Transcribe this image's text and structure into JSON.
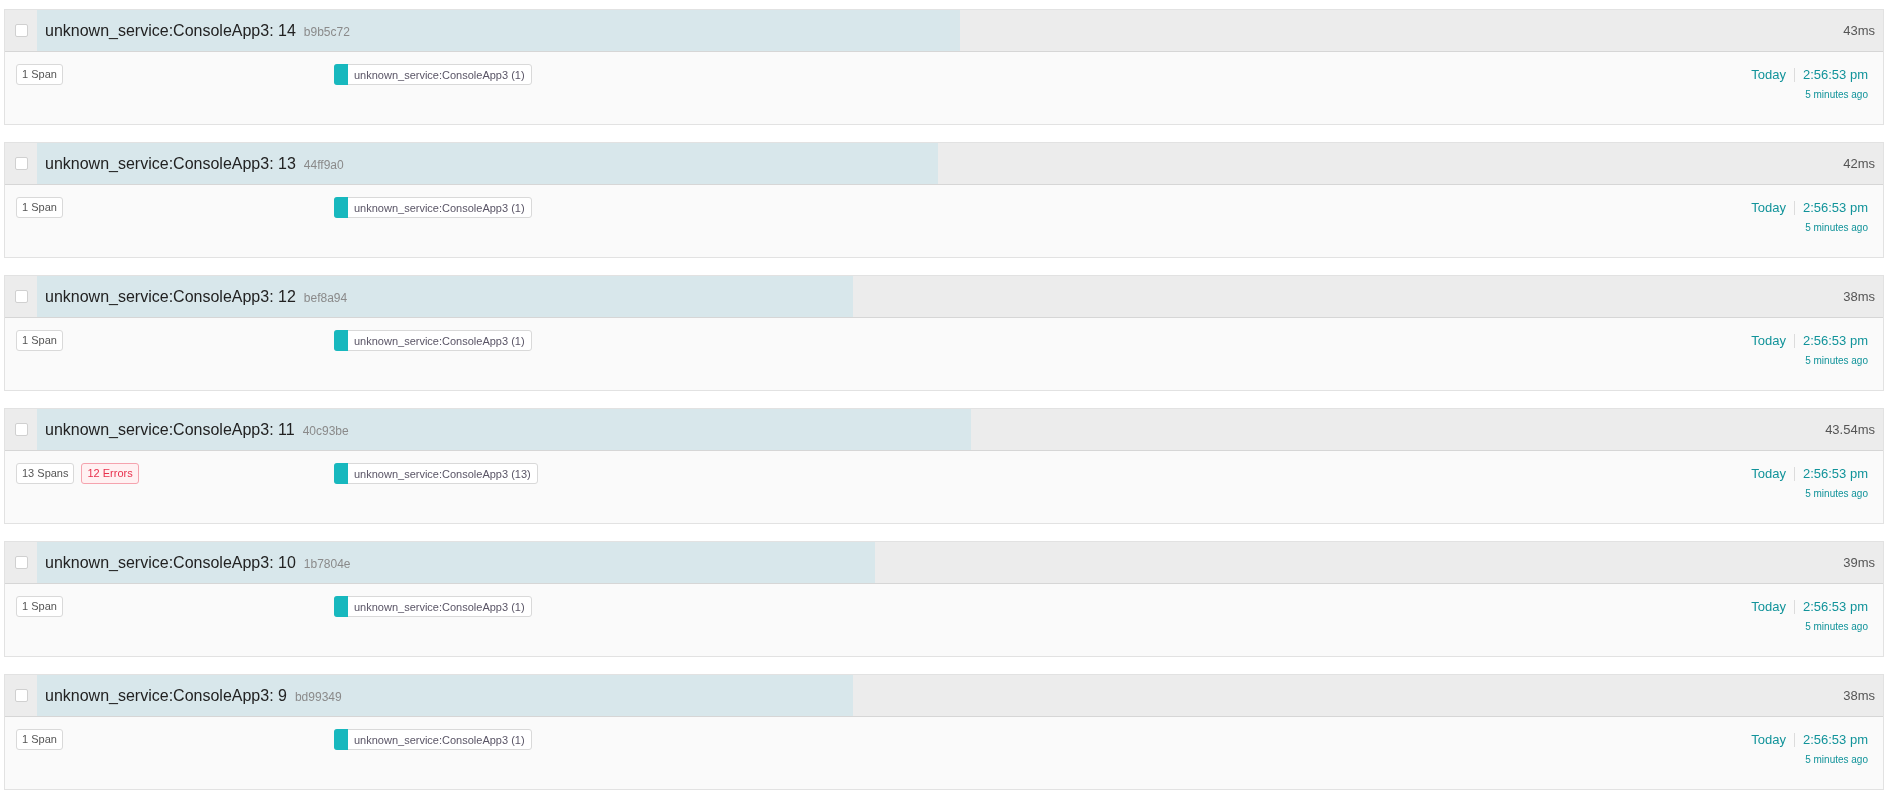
{
  "traces": [
    {
      "checked": false,
      "title": "unknown_service:ConsoleApp3: 14",
      "trace_id": "b9b5c72",
      "duration": "43ms",
      "level": 0.5,
      "tags": [
        {
          "kind": "spans",
          "label": "1 Span"
        }
      ],
      "services": [
        {
          "name": "unknown_service:ConsoleApp3 (1)",
          "color": "#17b8be"
        }
      ],
      "date": "Today",
      "time": "2:56:53 pm",
      "ago": "5 minutes ago"
    },
    {
      "checked": false,
      "title": "unknown_service:ConsoleApp3: 13",
      "trace_id": "44ff9a0",
      "duration": "42ms",
      "level": 0.488,
      "tags": [
        {
          "kind": "spans",
          "label": "1 Span"
        }
      ],
      "services": [
        {
          "name": "unknown_service:ConsoleApp3 (1)",
          "color": "#17b8be"
        }
      ],
      "date": "Today",
      "time": "2:56:53 pm",
      "ago": "5 minutes ago"
    },
    {
      "checked": false,
      "title": "unknown_service:ConsoleApp3: 12",
      "trace_id": "bef8a94",
      "duration": "38ms",
      "level": 0.442,
      "tags": [
        {
          "kind": "spans",
          "label": "1 Span"
        }
      ],
      "services": [
        {
          "name": "unknown_service:ConsoleApp3 (1)",
          "color": "#17b8be"
        }
      ],
      "date": "Today",
      "time": "2:56:53 pm",
      "ago": "5 minutes ago"
    },
    {
      "checked": false,
      "title": "unknown_service:ConsoleApp3: 11",
      "trace_id": "40c93be",
      "duration": "43.54ms",
      "level": 0.506,
      "tags": [
        {
          "kind": "spans",
          "label": "13 Spans"
        },
        {
          "kind": "errors",
          "label": "12 Errors"
        }
      ],
      "services": [
        {
          "name": "unknown_service:ConsoleApp3 (13)",
          "color": "#17b8be"
        }
      ],
      "date": "Today",
      "time": "2:56:53 pm",
      "ago": "5 minutes ago"
    },
    {
      "checked": false,
      "title": "unknown_service:ConsoleApp3: 10",
      "trace_id": "1b7804e",
      "duration": "39ms",
      "level": 0.454,
      "tags": [
        {
          "kind": "spans",
          "label": "1 Span"
        }
      ],
      "services": [
        {
          "name": "unknown_service:ConsoleApp3 (1)",
          "color": "#17b8be"
        }
      ],
      "date": "Today",
      "time": "2:56:53 pm",
      "ago": "5 minutes ago"
    },
    {
      "checked": false,
      "title": "unknown_service:ConsoleApp3: 9",
      "trace_id": "bd99349",
      "duration": "38ms",
      "level": 0.442,
      "tags": [
        {
          "kind": "spans",
          "label": "1 Span"
        }
      ],
      "services": [
        {
          "name": "unknown_service:ConsoleApp3 (1)",
          "color": "#17b8be"
        }
      ],
      "date": "Today",
      "time": "2:56:53 pm",
      "ago": "5 minutes ago"
    }
  ]
}
